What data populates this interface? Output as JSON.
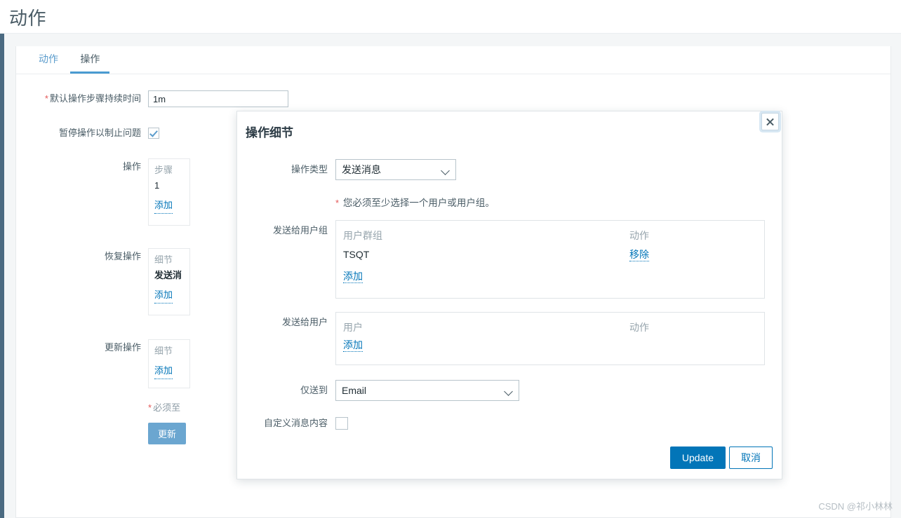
{
  "page": {
    "title": "动作"
  },
  "tabs": [
    {
      "label": "动作",
      "active": false
    },
    {
      "label": "操作",
      "active": true
    }
  ],
  "form": {
    "default_duration": {
      "label": "默认操作步骤持续时间",
      "required": true,
      "value": "1m"
    },
    "pause_ops": {
      "label": "暂停操作以制止问题",
      "checked": true
    },
    "operations": {
      "label": "操作",
      "header": "步骤",
      "rows": [
        "1"
      ],
      "add_label": "添加"
    },
    "recovery_operations": {
      "label": "恢复操作",
      "header": "细节",
      "rows": [
        "发送消"
      ],
      "add_label": "添加"
    },
    "update_operations": {
      "label": "更新操作",
      "header": "细节",
      "rows": [],
      "add_label": "添加"
    },
    "required_note": "必须至",
    "update_button": "更新"
  },
  "modal": {
    "title": "操作细节",
    "close_icon": "close-icon",
    "operation_type": {
      "label": "操作类型",
      "value": "发送消息",
      "caret_icon": "chevron-down-icon"
    },
    "validation_hint": {
      "marker": "*",
      "text": "您必须至少选择一个用户或用户组。"
    },
    "send_to_user_groups": {
      "label": "发送给用户组",
      "columns": [
        "用户群组",
        "动作"
      ],
      "rows": [
        {
          "name": "TSQT",
          "action": "移除"
        }
      ],
      "add_label": "添加"
    },
    "send_to_users": {
      "label": "发送给用户",
      "columns": [
        "用户",
        "动作"
      ],
      "rows": [],
      "add_label": "添加"
    },
    "send_only_to": {
      "label": "仅送到",
      "value": "Email",
      "caret_icon": "chevron-down-icon"
    },
    "custom_message": {
      "label": "自定义消息内容",
      "checked": false
    },
    "footer": {
      "primary": "Update",
      "cancel": "取消"
    }
  },
  "watermark": "CSDN @祁小林林",
  "colors": {
    "accent": "#0275b8",
    "tab_active_underline": "#4a9bd1",
    "required_red": "#e45959",
    "rail": "#4b6a81",
    "muted_text": "#97a5ad"
  }
}
